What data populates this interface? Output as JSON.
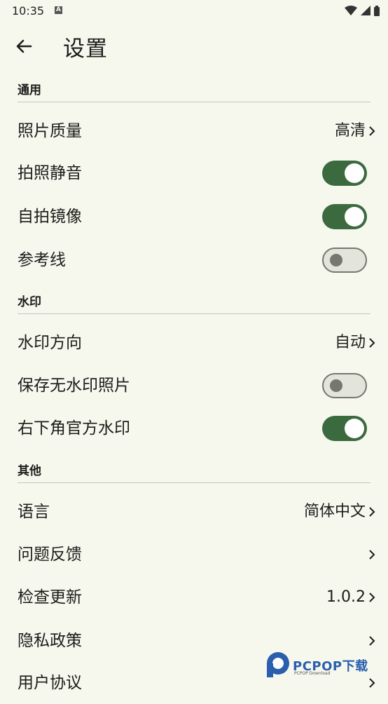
{
  "status_bar": {
    "time": "10:35",
    "notification_letter": "A"
  },
  "header": {
    "title": "设置"
  },
  "sections": {
    "general": {
      "title": "通用"
    },
    "watermark": {
      "title": "水印"
    },
    "other": {
      "title": "其他"
    }
  },
  "rows": {
    "photo_quality": {
      "label": "照片质量",
      "value": "高清"
    },
    "shutter_mute": {
      "label": "拍照静音",
      "toggle": true
    },
    "selfie_mirror": {
      "label": "自拍镜像",
      "toggle": true
    },
    "grid_lines": {
      "label": "参考线",
      "toggle": false
    },
    "watermark_direction": {
      "label": "水印方向",
      "value": "自动"
    },
    "save_without_watermark": {
      "label": "保存无水印照片",
      "toggle": false
    },
    "official_watermark": {
      "label": "右下角官方水印",
      "toggle": true
    },
    "language": {
      "label": "语言",
      "value": "简体中文"
    },
    "feedback": {
      "label": "问题反馈"
    },
    "check_update": {
      "label": "检查更新",
      "value": "1.0.2"
    },
    "privacy_policy": {
      "label": "隐私政策"
    },
    "user_agreement": {
      "label": "用户协议"
    }
  },
  "watermark_overlay": {
    "brand": "PCPOP下载",
    "sub": "PCPOP Download"
  },
  "colors": {
    "accent": "#3b6a3e",
    "background": "#f6f8ee",
    "divider": "#c4c6bd"
  }
}
